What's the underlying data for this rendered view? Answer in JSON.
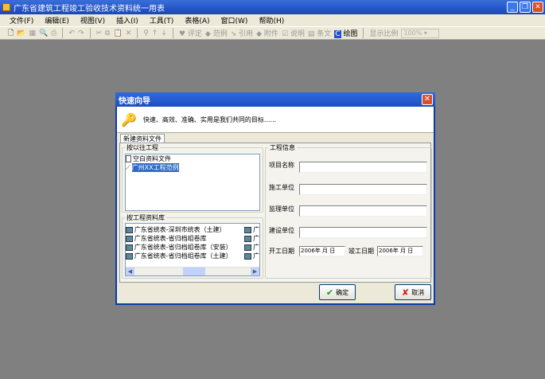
{
  "app": {
    "title": "广东省建筑工程竣工验收技术资料统一用表"
  },
  "window_buttons": [
    "minimize",
    "restore",
    "close"
  ],
  "menu": [
    "文件(F)",
    "编辑(E)",
    "视图(V)",
    "插入(I)",
    "工具(T)",
    "表格(A)",
    "窗口(W)",
    "帮助(H)"
  ],
  "toolbar": {
    "items": [
      "评定",
      "范例",
      "引用",
      "附件",
      "说明",
      "条文",
      "绘图"
    ],
    "zoom_label": "显示比例",
    "zoom_value": "100%"
  },
  "dialog": {
    "title": "快速向导",
    "banner": "快速、高效、准确、实用是我们共同的目标......",
    "tab": "新建资料文件",
    "past_group": "按以往工程",
    "past_items": [
      {
        "label": "空白资料文件",
        "selected": false
      },
      {
        "label": "广州XX工程范例",
        "selected": true
      }
    ],
    "lib_group": "按工程资料库",
    "lib_items": [
      "广东省统表-深圳市统表（土建）",
      "广东省统表-省归档组卷库",
      "广东省统表-省归档组卷库（安装）",
      "广东省统表-省归档组卷库（土建）"
    ],
    "lib_items_col2": [
      "广",
      "广",
      "广",
      "广"
    ],
    "info_group": "工程信息",
    "fields": [
      {
        "label": "项目名称",
        "value": ""
      },
      {
        "label": "施工单位",
        "value": ""
      },
      {
        "label": "监理单位",
        "value": ""
      },
      {
        "label": "建设单位",
        "value": ""
      }
    ],
    "start_label": "开工日期",
    "start_value": "2006年 月 日",
    "end_label": "竣工日期",
    "end_value": "2006年 月 日",
    "ok": "确定",
    "cancel": "取消"
  }
}
